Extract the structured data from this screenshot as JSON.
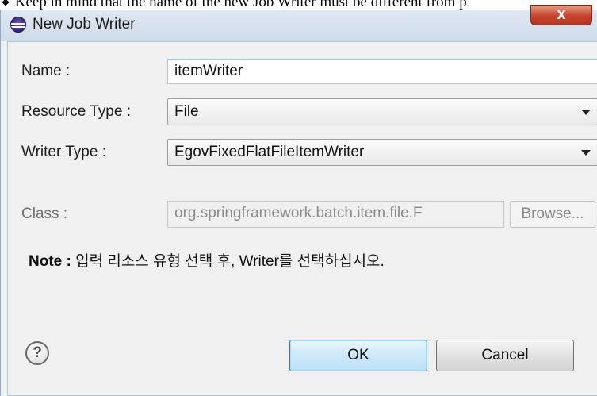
{
  "caption": {
    "bullet": "◆",
    "text": "Keep in mind that the name of the new Job Writer must be different from p"
  },
  "window": {
    "title": "New Job Writer",
    "close_glyph": "X"
  },
  "form": {
    "name_label": "Name :",
    "name_value": "itemWriter",
    "resource_type_label": "Resource Type :",
    "resource_type_value": "File",
    "writer_type_label": "Writer Type :",
    "writer_type_value": "EgovFixedFlatFileItemWriter",
    "class_label": "Class :",
    "class_value": "org.springframework.batch.item.file.F",
    "browse_label": "Browse..."
  },
  "note": {
    "label": "Note :",
    "text": "입력 리소스 유형 선택 후, Writer를 선택하십시오."
  },
  "footer": {
    "help_glyph": "?",
    "ok_label": "OK",
    "cancel_label": "Cancel"
  },
  "icons": {
    "title_icon": "eclipse-icon",
    "help_icon": "help-icon",
    "close_icon": "close-icon",
    "dropdown_icon": "chevron-down-icon"
  },
  "colors": {
    "ok_border": "#3c7fb1",
    "close_button": "#c6452c"
  }
}
